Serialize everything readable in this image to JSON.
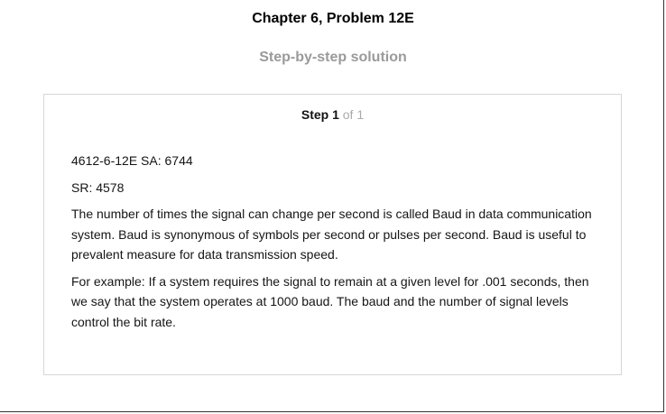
{
  "header": {
    "chapter_title": "Chapter 6, Problem 12E",
    "subtitle": "Step-by-step solution"
  },
  "step": {
    "label": "Step 1",
    "of_text": " of 1",
    "paragraphs": [
      "4612-6-12E SA: 6744",
      "SR: 4578",
      "The number of times the signal can change per second is called Baud in data communication system. Baud is synonymous of symbols per second or pulses per second. Baud is useful to prevalent measure for data transmission speed.",
      "For example: If a system requires the signal to remain at a given level for .001 seconds, then we say that the system operates at 1000 baud. The baud and the number of signal levels control the bit rate."
    ]
  }
}
